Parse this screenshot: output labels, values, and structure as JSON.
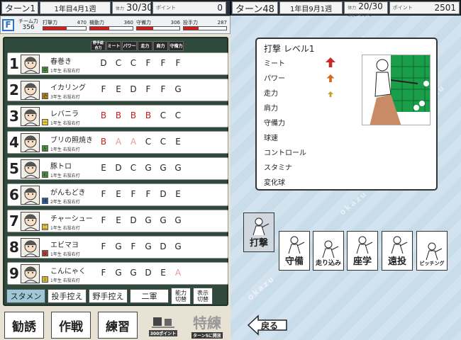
{
  "left_header": {
    "turn": "ターン1",
    "date": "1年目4月1週",
    "vital_label": "体力",
    "vital": "30/30",
    "points_label": "ポイント",
    "points": "0"
  },
  "right_header": {
    "turn": "ターン48",
    "date": "1年目9月1週",
    "vital_label": "体力",
    "vital": "20/30",
    "vital_sub": "あと2:40で+1",
    "points_label": "ポイント",
    "points": "2501"
  },
  "team_stats": {
    "badge": "F",
    "team_power_label": "チーム力",
    "team_power": "356",
    "stats": [
      {
        "label": "打撃力",
        "value": "470",
        "fill": 0.55
      },
      {
        "label": "機動力",
        "value": "360",
        "fill": 0.45
      },
      {
        "label": "守備力",
        "value": "306",
        "fill": 0.38
      },
      {
        "label": "投手力",
        "value": "287",
        "fill": 0.35
      }
    ]
  },
  "columns": [
    "野手総合力",
    "ミート",
    "パワー",
    "走力",
    "肩力",
    "守備力"
  ],
  "players": [
    {
      "num": "1",
      "name": "春巻き",
      "pos": "中",
      "pos_color": "#4b9e3b",
      "info": "1年生 右投右打",
      "grades": [
        "D",
        "C",
        "C",
        "F",
        "F",
        "F"
      ],
      "colors": [
        "n",
        "n",
        "n",
        "n",
        "n",
        "n"
      ]
    },
    {
      "num": "2",
      "name": "イカリング",
      "pos": "遊",
      "pos_color": "#d49a1c",
      "info": "3年生 右投右打",
      "grades": [
        "F",
        "E",
        "D",
        "F",
        "F",
        "G"
      ],
      "colors": [
        "n",
        "n",
        "n",
        "n",
        "n",
        "n"
      ]
    },
    {
      "num": "3",
      "name": "レバニラ",
      "pos": "一",
      "pos_color": "#e8c838",
      "info": "1年生 右投右打",
      "grades": [
        "B",
        "B",
        "B",
        "B",
        "C",
        "C"
      ],
      "colors": [
        "r",
        "r",
        "r",
        "r",
        "n",
        "n"
      ]
    },
    {
      "num": "4",
      "name": "ブリの照焼き",
      "pos": "左",
      "pos_color": "#4b9e3b",
      "info": "1年生 右投右打",
      "grades": [
        "B",
        "A",
        "A",
        "C",
        "C",
        "E"
      ],
      "colors": [
        "r",
        "p",
        "p",
        "n",
        "n",
        "n"
      ]
    },
    {
      "num": "5",
      "name": "豚トロ",
      "pos": "右",
      "pos_color": "#4b9e3b",
      "info": "1年生 右投右打",
      "grades": [
        "E",
        "D",
        "C",
        "G",
        "G",
        "G"
      ],
      "colors": [
        "n",
        "n",
        "n",
        "n",
        "n",
        "n"
      ]
    },
    {
      "num": "6",
      "name": "がんもどき",
      "pos": "捕",
      "pos_color": "#2d6cc0",
      "info": "2年生 右投右打",
      "grades": [
        "F",
        "E",
        "F",
        "F",
        "D",
        "E"
      ],
      "colors": [
        "n",
        "n",
        "n",
        "n",
        "n",
        "n"
      ]
    },
    {
      "num": "7",
      "name": "チャーシュー",
      "pos": "二",
      "pos_color": "#e8c838",
      "info": "1年生 右投右打",
      "grades": [
        "F",
        "E",
        "D",
        "G",
        "G",
        "G"
      ],
      "colors": [
        "n",
        "n",
        "n",
        "n",
        "n",
        "n"
      ]
    },
    {
      "num": "8",
      "name": "エビマヨ",
      "pos": "投",
      "pos_color": "#d64a3a",
      "info": "1年生 右投右打",
      "grades": [
        "F",
        "G",
        "F",
        "G",
        "D",
        "G"
      ],
      "colors": [
        "n",
        "n",
        "n",
        "n",
        "n",
        "n"
      ]
    },
    {
      "num": "9",
      "name": "こんにゃく",
      "pos": "三",
      "pos_color": "#e8c838",
      "info": "1年生 右投右打",
      "grades": [
        "F",
        "G",
        "G",
        "D",
        "E",
        "A"
      ],
      "colors": [
        "n",
        "n",
        "n",
        "n",
        "n",
        "p"
      ]
    }
  ],
  "tabs": {
    "starters": "スタメン",
    "pitcher_bench": "投手控え",
    "fielder_bench": "野手控え",
    "second_team": "二軍",
    "ability_toggle": "能力切替",
    "display_toggle": "表示切替"
  },
  "bottom_menu": {
    "recruit": "勧誘",
    "tactics": "作戦",
    "practice": "練習",
    "boost_label": "300ポイント",
    "special": "特練",
    "special_sub": "ターン5に開放"
  },
  "skill_panel": {
    "title": "打撃 レベル1",
    "stats": [
      "ミート",
      "パワー",
      "走力",
      "肩力",
      "守備力",
      "球速",
      "コントロール",
      "スタミナ",
      "変化球"
    ],
    "arrows": [
      {
        "row": 0,
        "color": "#c92a2a",
        "size": "big"
      },
      {
        "row": 1,
        "color": "#d46a1a",
        "size": "mid"
      },
      {
        "row": 2,
        "color": "#c9a21a",
        "size": "small"
      }
    ]
  },
  "training_buttons": [
    "打撃",
    "守備",
    "走り込み",
    "座学",
    "遠投",
    "ピッチング"
  ],
  "back_button": "戻る",
  "watermark": "okazu"
}
